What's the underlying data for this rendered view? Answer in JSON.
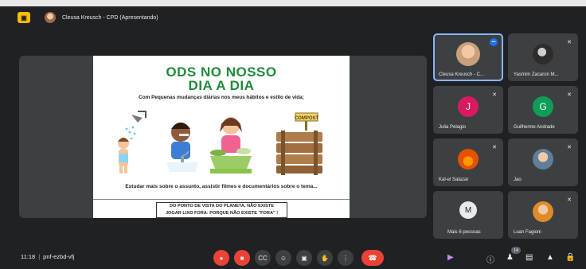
{
  "presenter": {
    "label": "Cleusa Kreusch - CPD (Apresentando)",
    "icon": "present-to-all-icon"
  },
  "slide": {
    "title_line1": "ODS NO NOSSO",
    "title_line2": "DIA A DIA",
    "subtitle": "Com Pequenas mudanças diárias nos meus hábitos e estilo de vida;",
    "sign_text": "COMPOST",
    "study_text": "Estudar mais sobre o assunto, assistir filmes e documentários sobre o tema...",
    "box_line1": "DO PONTO DE VISTA DO PLANETA, NÃO EXISTE",
    "box_line2": "JOGAR LIXO FORA:  PORQUE NÃO EXISTE \"FORA\" !"
  },
  "participants": [
    {
      "name": "Cleusa Kreusch - C...",
      "initial": "",
      "color": "#c9a07a",
      "speaking_badge": "•••"
    },
    {
      "name": "Yasmim Zacaron M...",
      "initial": "",
      "color": "#2d2d2d"
    },
    {
      "name": "Julia Pelagio",
      "initial": "J",
      "color": "#d81b60"
    },
    {
      "name": "Guilherme Andrade",
      "initial": "G",
      "color": "#0f9d58"
    },
    {
      "name": "Kal-el Salazar",
      "initial": "",
      "color": "#e65100"
    },
    {
      "name": "Jao",
      "initial": "",
      "color": "#5f7f9a"
    },
    {
      "name": "Mais 6 pessoas",
      "initial": "M",
      "color": "#e8eaed"
    },
    {
      "name": "Luan Fagioni",
      "initial": "",
      "color": "#e08a2a"
    }
  ],
  "bottombar": {
    "time": "11:18",
    "meeting_code": "pnf-ezbd-vfj",
    "participant_count": "14",
    "controls": [
      "mic-off-icon",
      "camera-off-icon",
      "captions-icon",
      "emoji-icon",
      "present-icon",
      "raise-hand-icon",
      "more-options-icon",
      "hang-up-icon"
    ],
    "right_icons": [
      "info-icon",
      "people-icon",
      "chat-icon",
      "activities-icon",
      "host-controls-icon"
    ]
  },
  "colors": {
    "background": "#202124",
    "tile": "#3c4043",
    "accent": "#8ab4f8",
    "danger": "#ea4335",
    "slide_title": "#1f8a3a"
  }
}
